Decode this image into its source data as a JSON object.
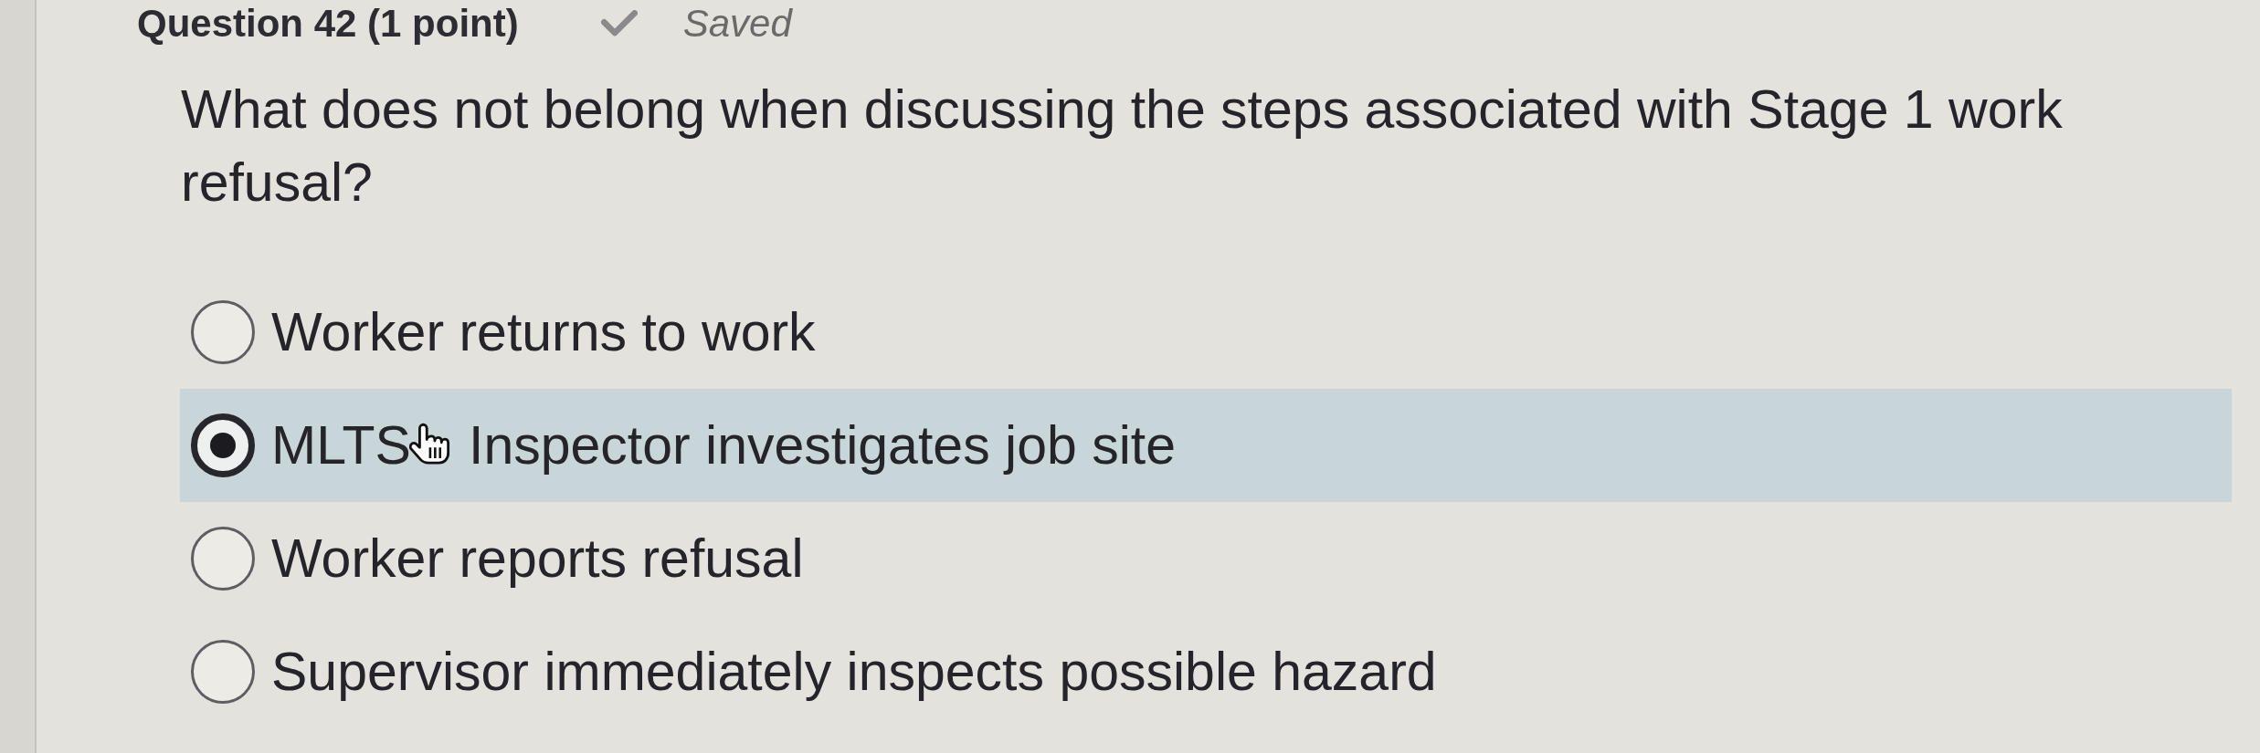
{
  "header": {
    "title": "Question 42 (1 point)",
    "status": "Saved"
  },
  "question": "What does not belong when discussing the steps associated with Stage 1 work refusal?",
  "options": [
    {
      "label": "Worker returns to work",
      "selected": false
    },
    {
      "label": "MLTS",
      "pointer": true,
      "label_after_cursor": "Inspector investigates job site",
      "selected": true
    },
    {
      "label": "Worker reports refusal",
      "selected": false
    },
    {
      "label": "Supervisor immediately inspects possible hazard",
      "selected": false
    }
  ]
}
